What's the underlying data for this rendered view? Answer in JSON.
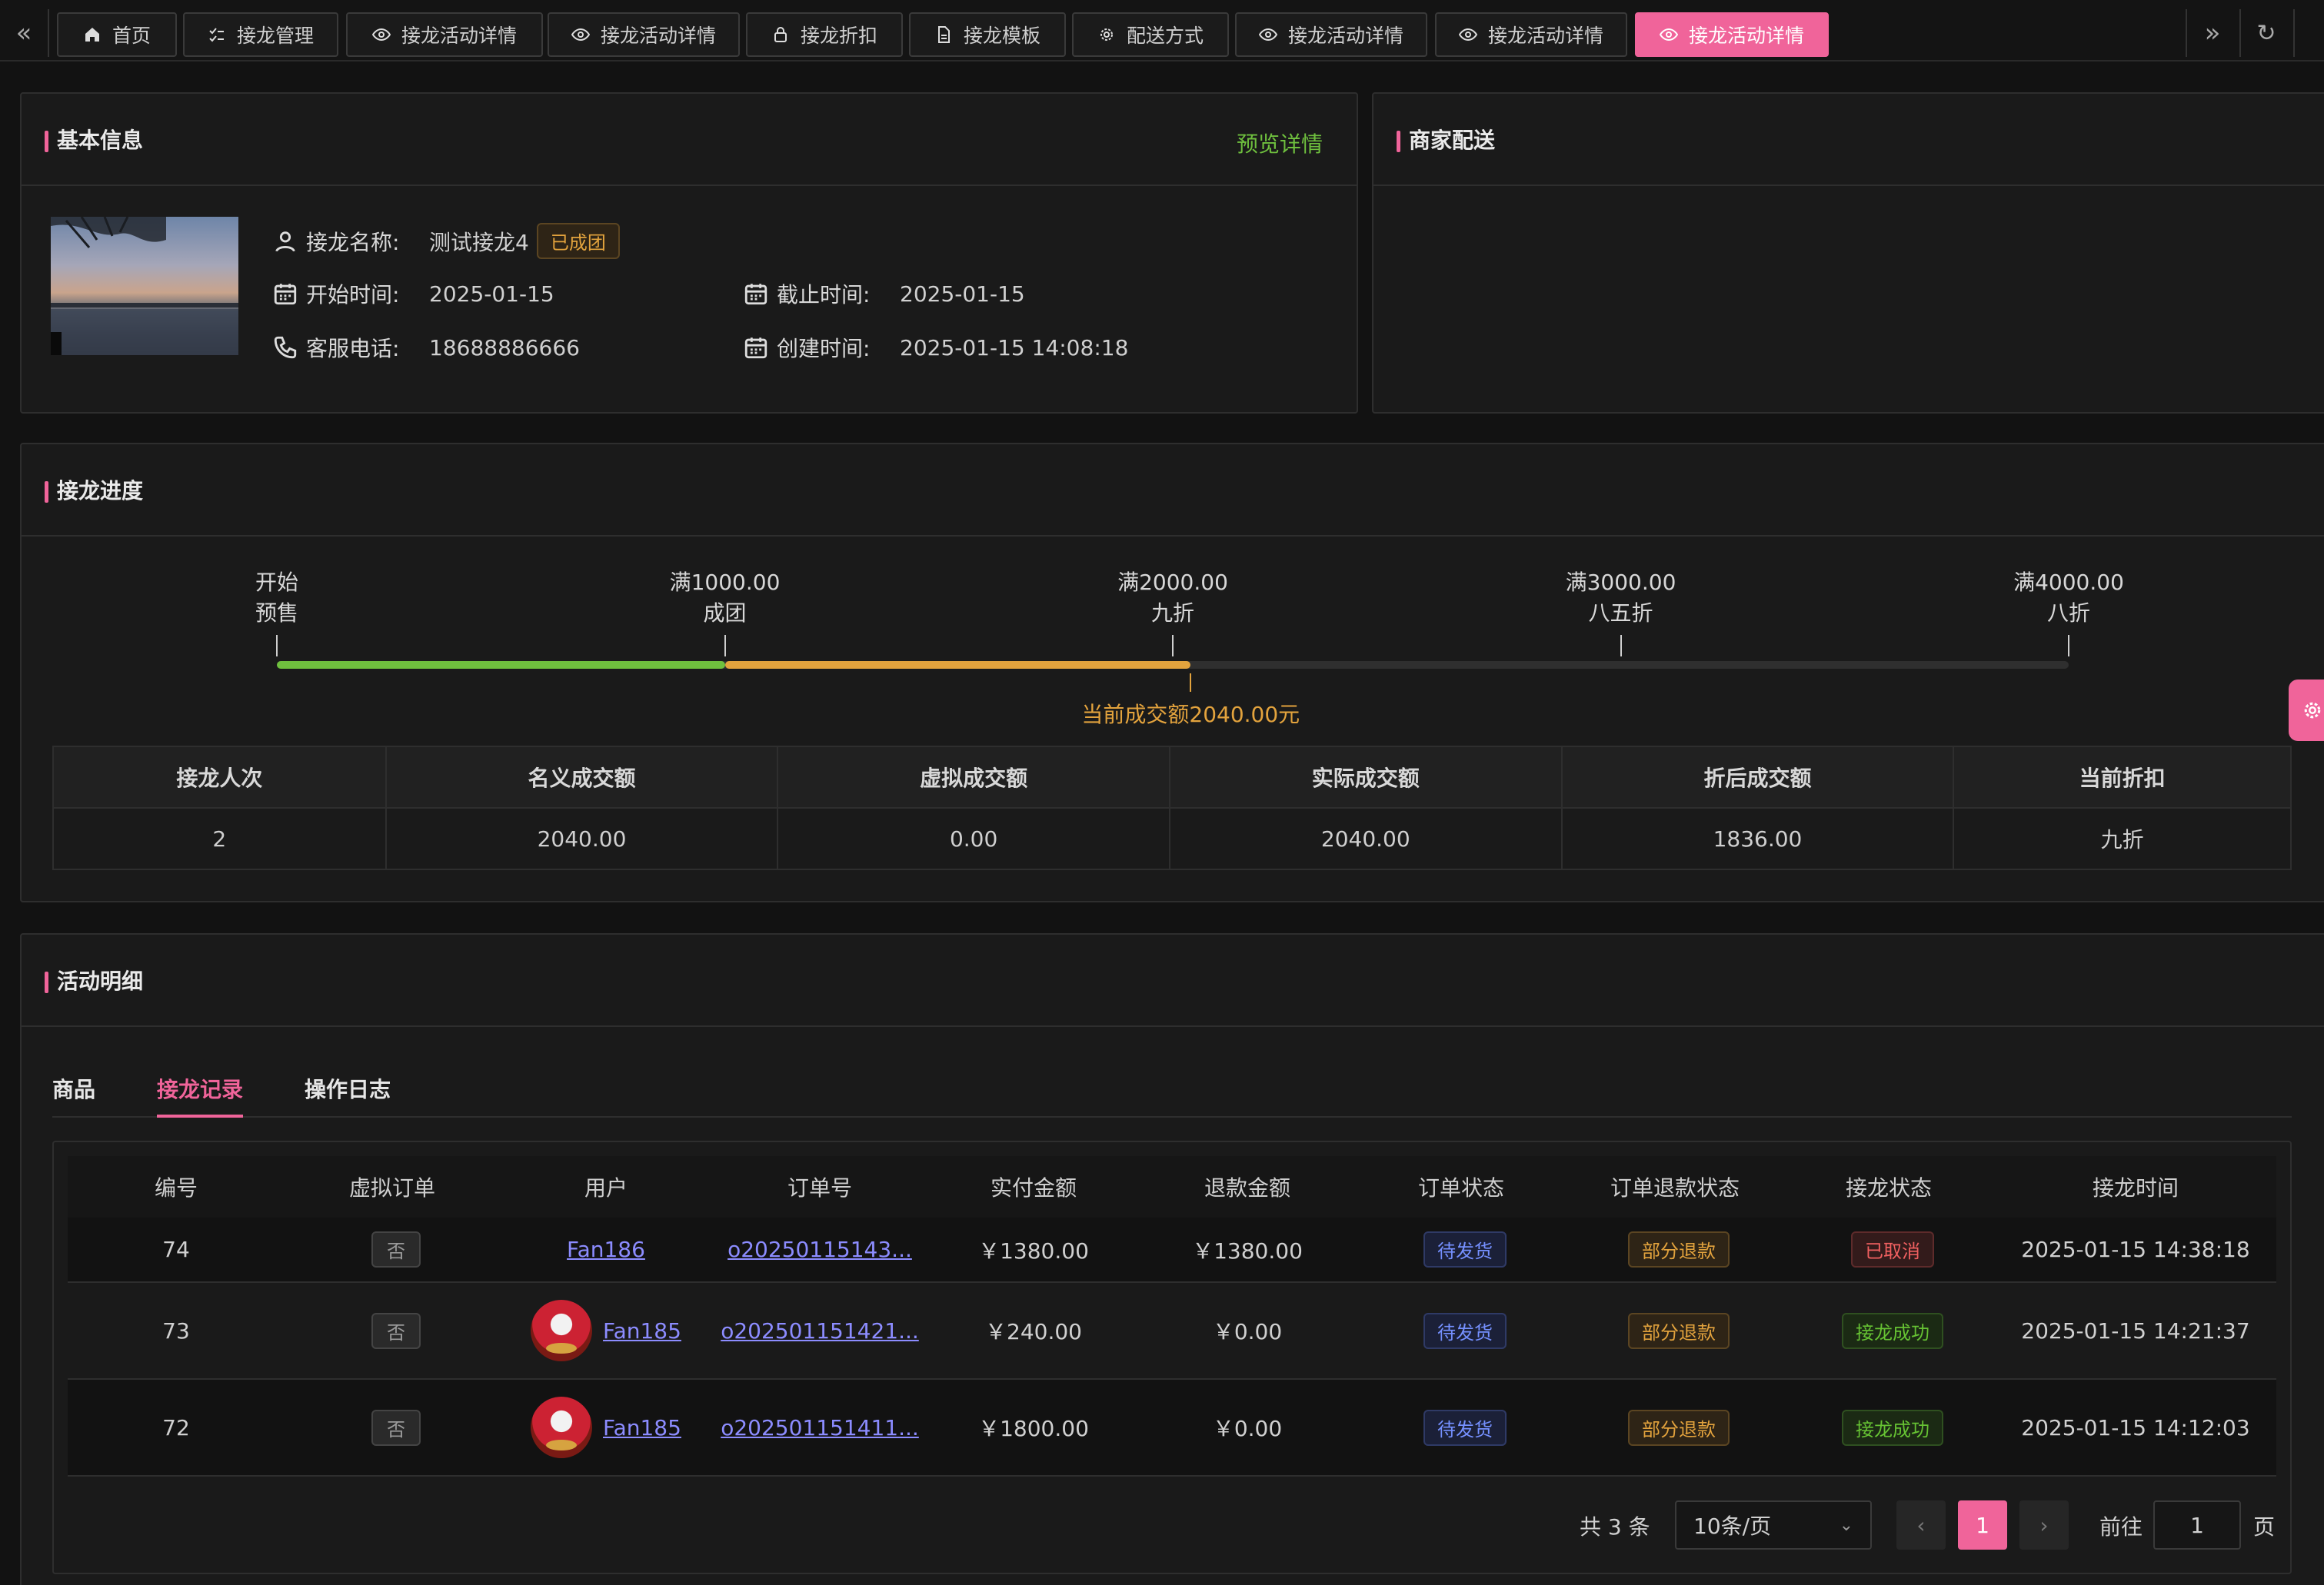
{
  "tabs": [
    {
      "label": "首页",
      "icon": "home-icon",
      "active": false
    },
    {
      "label": "接龙管理",
      "icon": "list-check-icon",
      "active": false
    },
    {
      "label": "接龙活动详情",
      "icon": "eye-icon",
      "active": false
    },
    {
      "label": "接龙活动详情",
      "icon": "eye-icon",
      "active": false
    },
    {
      "label": "接龙折扣",
      "icon": "lock-icon",
      "active": false
    },
    {
      "label": "接龙模板",
      "icon": "document-icon",
      "active": false
    },
    {
      "label": "配送方式",
      "icon": "gear-icon",
      "active": false
    },
    {
      "label": "接龙活动详情",
      "icon": "eye-icon",
      "active": false
    },
    {
      "label": "接龙活动详情",
      "icon": "eye-icon",
      "active": false
    },
    {
      "label": "接龙活动详情",
      "icon": "eye-icon",
      "active": true
    }
  ],
  "basic": {
    "title": "基本信息",
    "preview_link": "预览详情",
    "name_label": "接龙名称:",
    "name_value": "测试接龙4",
    "status_tag": "已成团",
    "start_label": "开始时间:",
    "start_value": "2025-01-15",
    "end_label": "截止时间:",
    "end_value": "2025-01-15",
    "phone_label": "客服电话:",
    "phone_value": "18688886666",
    "created_label": "创建时间:",
    "created_value": "2025-01-15 14:08:18"
  },
  "merchant": {
    "title": "商家配送"
  },
  "progress": {
    "title": "接龙进度",
    "milestones": [
      {
        "top": "开始",
        "bottom": "预售"
      },
      {
        "top": "满1000.00",
        "bottom": "成团"
      },
      {
        "top": "满2000.00",
        "bottom": "九折"
      },
      {
        "top": "满3000.00",
        "bottom": "八五折"
      },
      {
        "top": "满4000.00",
        "bottom": "八折"
      }
    ],
    "current_text": "当前成交额2040.00元",
    "current_amount": 2040.0,
    "max_amount": 4000.0,
    "colors": {
      "green": "#6fc03e",
      "orange": "#e3a33d",
      "track": "#2f2f2f"
    }
  },
  "summary": {
    "headers": [
      "接龙人次",
      "名义成交额",
      "虚拟成交额",
      "实际成交额",
      "折后成交额",
      "当前折扣"
    ],
    "values": [
      "2",
      "2040.00",
      "0.00",
      "2040.00",
      "1836.00",
      "九折"
    ]
  },
  "details": {
    "title": "活动明细",
    "tabs": [
      "商品",
      "接龙记录",
      "操作日志"
    ],
    "active_tab": "接龙记录",
    "columns": [
      "编号",
      "虚拟订单",
      "用户",
      "订单号",
      "实付金额",
      "退款金额",
      "订单状态",
      "订单退款状态",
      "接龙状态",
      "接龙时间"
    ],
    "rows": [
      {
        "id": "74",
        "virtual": "否",
        "user": "Fan186",
        "avatar": false,
        "order": "o20250115143...",
        "paid": "￥1380.00",
        "refund": "￥1380.00",
        "order_status": "待发货",
        "refund_status": "部分退款",
        "status": "已取消",
        "status_color": "red",
        "time": "2025-01-15 14:38:18"
      },
      {
        "id": "73",
        "virtual": "否",
        "user": "Fan185",
        "avatar": true,
        "order": "o202501151421...",
        "paid": "￥240.00",
        "refund": "￥0.00",
        "order_status": "待发货",
        "refund_status": "部分退款",
        "status": "接龙成功",
        "status_color": "green",
        "time": "2025-01-15 14:21:37"
      },
      {
        "id": "72",
        "virtual": "否",
        "user": "Fan185",
        "avatar": true,
        "order": "o202501151411...",
        "paid": "￥1800.00",
        "refund": "￥0.00",
        "order_status": "待发货",
        "refund_status": "部分退款",
        "status": "接龙成功",
        "status_color": "green",
        "time": "2025-01-15 14:12:03"
      }
    ]
  },
  "pagination": {
    "total": "共 3 条",
    "page_size": "10条/页",
    "current_page": "1",
    "goto_label": "前往",
    "goto_value": "1",
    "page_suffix": "页"
  },
  "accent": "#f0649a"
}
